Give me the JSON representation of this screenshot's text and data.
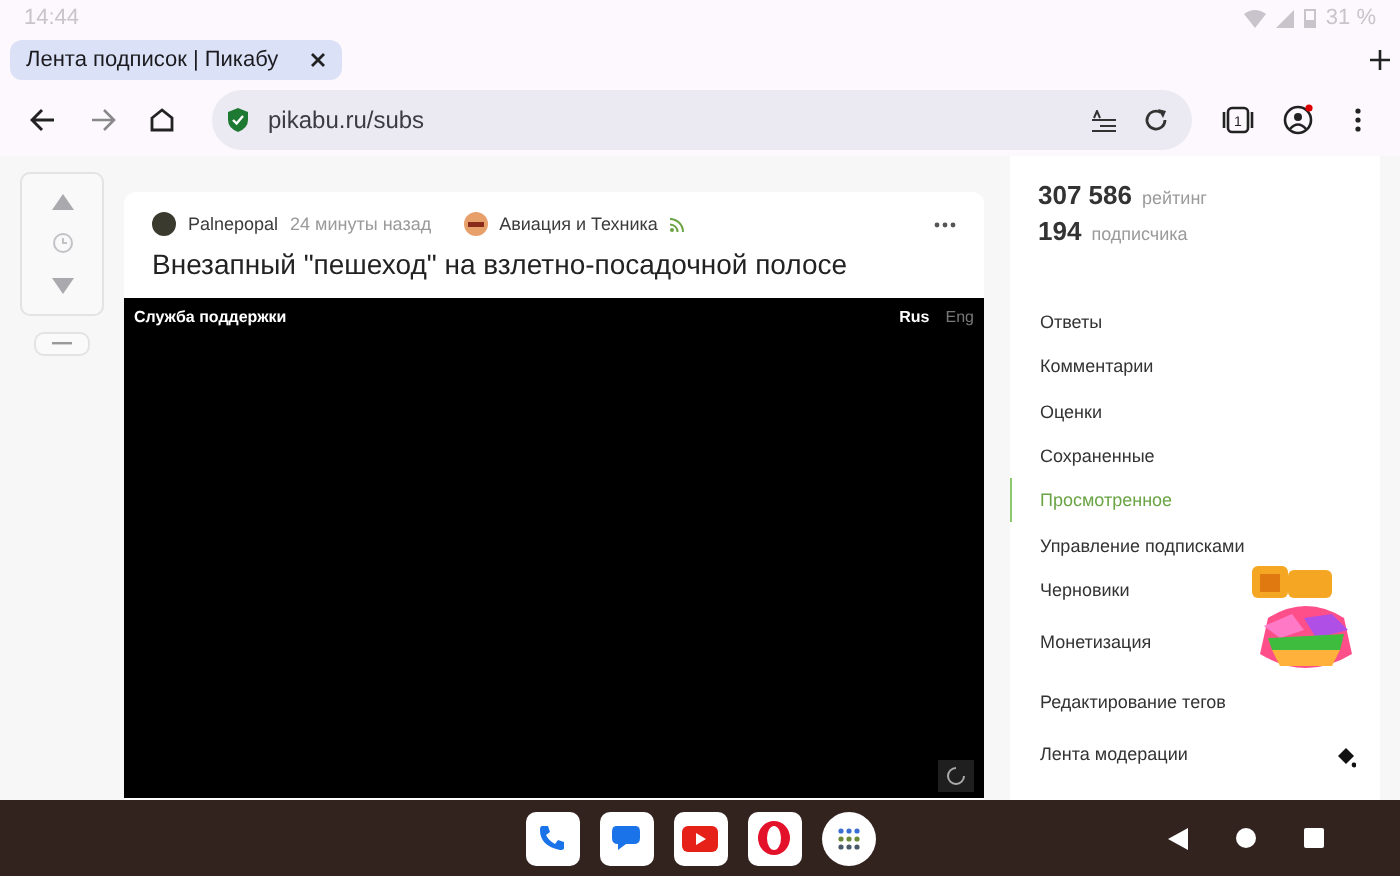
{
  "status_bar": {
    "time": "14:44",
    "battery": "31 %"
  },
  "browser_tab": {
    "title": "Лента подписок | Пикабу"
  },
  "address_bar": {
    "url": "pikabu.ru/subs",
    "tab_count": "1"
  },
  "post": {
    "author": "Palnepopal",
    "time": "24 минуты назад",
    "community": "Авиация и Техника",
    "title": "Внезапный \"пешеход\" на взлетно-посадочной полосе",
    "video": {
      "caption": "Служба поддержки",
      "languages": [
        {
          "label": "Rus",
          "selected": true
        },
        {
          "label": "Eng",
          "selected": false
        }
      ]
    }
  },
  "profile": {
    "rating": "307 586",
    "rating_label": "рейтинг",
    "subscribers": "194",
    "subscribers_label": "подписчика"
  },
  "menu": [
    {
      "label": "Ответы",
      "selected": false
    },
    {
      "label": "Комментарии",
      "selected": false
    },
    {
      "label": "Оценки",
      "selected": false
    },
    {
      "label": "Сохраненные",
      "selected": false
    },
    {
      "label": "Просмотренное",
      "selected": true
    },
    {
      "label": "Управление подписками",
      "selected": false
    },
    {
      "label": "Черновики",
      "selected": false
    },
    {
      "label": "Монетизация",
      "selected": false
    },
    {
      "label": "Редактирование тегов",
      "selected": false
    },
    {
      "label": "Лента модерации",
      "selected": false
    }
  ]
}
